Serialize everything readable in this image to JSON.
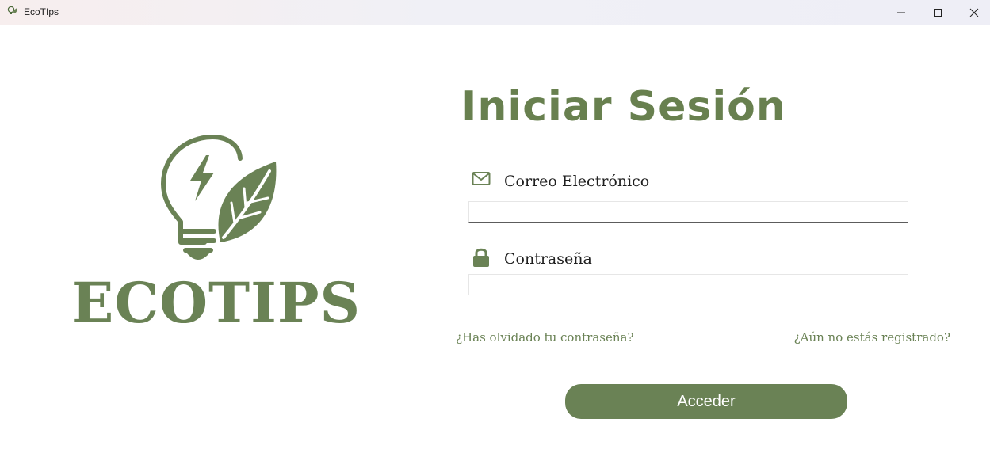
{
  "window": {
    "title": "EcoTIps",
    "controls": {
      "minimize": "minimize-icon",
      "maximize": "maximize-icon",
      "close": "close-icon"
    }
  },
  "brand": {
    "logo_icon": "lightbulb-leaf-icon",
    "name": "ECOTIPS",
    "color": "#6a8255"
  },
  "login": {
    "title": "Iniciar Sesión",
    "email": {
      "icon": "envelope-icon",
      "label": "Correo Electrónico",
      "value": "",
      "placeholder": ""
    },
    "password": {
      "icon": "lock-icon",
      "label": "Contraseña",
      "value": "",
      "placeholder": ""
    },
    "forgot_link": "¿Has olvidado tu contraseña?",
    "register_link": "¿Aún no estás registrado?",
    "submit_label": "Acceder"
  },
  "colors": {
    "accent": "#6a8255",
    "background": "#ffffff"
  }
}
